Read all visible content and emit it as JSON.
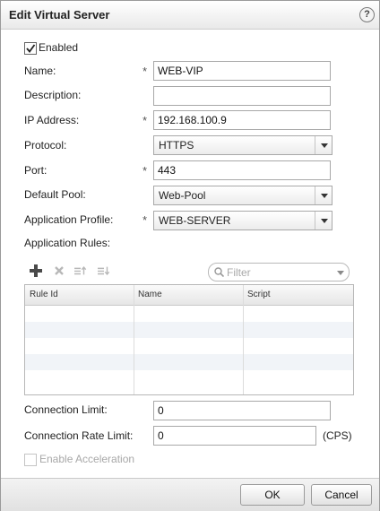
{
  "dialog": {
    "title": "Edit Virtual Server",
    "help_symbol": "?"
  },
  "form": {
    "enabled": {
      "label": "Enabled",
      "checked": true
    },
    "name": {
      "label": "Name:",
      "value": "WEB-VIP",
      "required_mark": "*"
    },
    "description": {
      "label": "Description:",
      "value": ""
    },
    "ip_address": {
      "label": "IP Address:",
      "value": "192.168.100.9",
      "required_mark": "*"
    },
    "protocol": {
      "label": "Protocol:",
      "value": "HTTPS"
    },
    "port": {
      "label": "Port:",
      "value": "443",
      "required_mark": "*"
    },
    "default_pool": {
      "label": "Default Pool:",
      "value": "Web-Pool"
    },
    "application_profile": {
      "label": "Application Profile:",
      "value": "WEB-SERVER",
      "required_mark": "*"
    },
    "application_rules": {
      "label": "Application Rules:"
    }
  },
  "rules_toolbar": {
    "filter_placeholder": "Filter"
  },
  "rules_table": {
    "columns": [
      "Rule Id",
      "Name",
      "Script"
    ],
    "rows": []
  },
  "limits": {
    "connection_limit": {
      "label": "Connection Limit:",
      "value": "0"
    },
    "connection_rate_limit": {
      "label": "Connection Rate Limit:",
      "value": "0",
      "unit": "(CPS)"
    },
    "enable_acceleration": {
      "label": "Enable Acceleration",
      "checked": false
    }
  },
  "buttons": {
    "ok": "OK",
    "cancel": "Cancel"
  },
  "colors": {
    "add_icon": "#4a4a4a",
    "disabled_icon": "#b8b8b8",
    "stripe": "#f1f4f8"
  }
}
